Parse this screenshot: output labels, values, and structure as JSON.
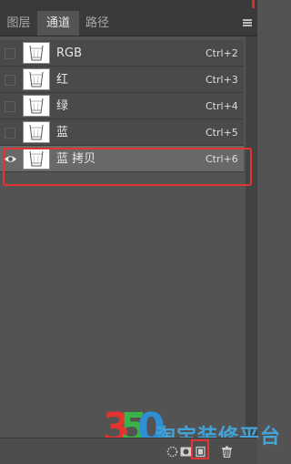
{
  "tabs": [
    {
      "label": "图层",
      "active": false
    },
    {
      "label": "通道",
      "active": true
    },
    {
      "label": "路径",
      "active": false
    }
  ],
  "channels": [
    {
      "name": "RGB",
      "shortcut": "Ctrl+2",
      "visible": false,
      "selected": false
    },
    {
      "name": "红",
      "shortcut": "Ctrl+3",
      "visible": false,
      "selected": false
    },
    {
      "name": "绿",
      "shortcut": "Ctrl+4",
      "visible": false,
      "selected": false
    },
    {
      "name": "蓝",
      "shortcut": "Ctrl+5",
      "visible": false,
      "selected": false
    },
    {
      "name": "蓝 拷贝",
      "shortcut": "Ctrl+6",
      "visible": true,
      "selected": true
    }
  ],
  "watermark": {
    "digits": [
      "3",
      "5",
      "0"
    ],
    "text": "淘宝装修平台"
  },
  "footer_icons": [
    "dotted-circle-icon",
    "mask-icon",
    "new-channel-icon",
    "trash-icon"
  ],
  "colors": {
    "highlight": "#e53434",
    "watermark_3": "#e3342f",
    "watermark_5": "#39b34a",
    "watermark_0": "#2f8fd4",
    "watermark_text": "#44a3d8"
  }
}
